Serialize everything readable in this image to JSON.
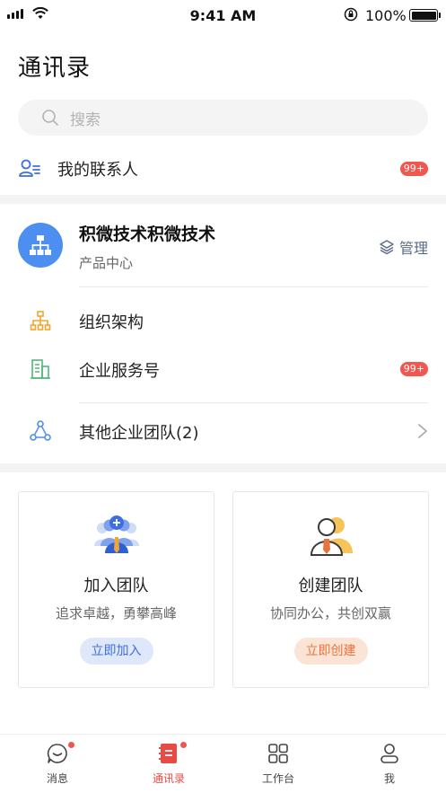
{
  "status_bar": {
    "time": "9:41 AM",
    "battery": "100%"
  },
  "header": {
    "title": "通讯录"
  },
  "search": {
    "placeholder": "搜索"
  },
  "my_contacts": {
    "label": "我的联系人",
    "badge": "99+"
  },
  "organization": {
    "name": "积微技术积微技术",
    "department": "产品中心",
    "manage_label": "管理"
  },
  "menu": {
    "org_structure": "组织架构",
    "service_accounts": "企业服务号",
    "service_badge": "99+",
    "other_teams": "其他企业团队(2)"
  },
  "cards": {
    "join": {
      "title": "加入团队",
      "subtitle": "追求卓越，勇攀高峰",
      "button": "立即加入"
    },
    "create": {
      "title": "创建团队",
      "subtitle": "协同办公，共创双赢",
      "button": "立即创建"
    }
  },
  "tabbar": {
    "messages": "消息",
    "contacts": "通讯录",
    "workbench": "工作台",
    "me": "我"
  },
  "colors": {
    "accent_blue": "#4d8ff0",
    "badge_red": "#f0574f",
    "active_tab": "#e94a44"
  }
}
